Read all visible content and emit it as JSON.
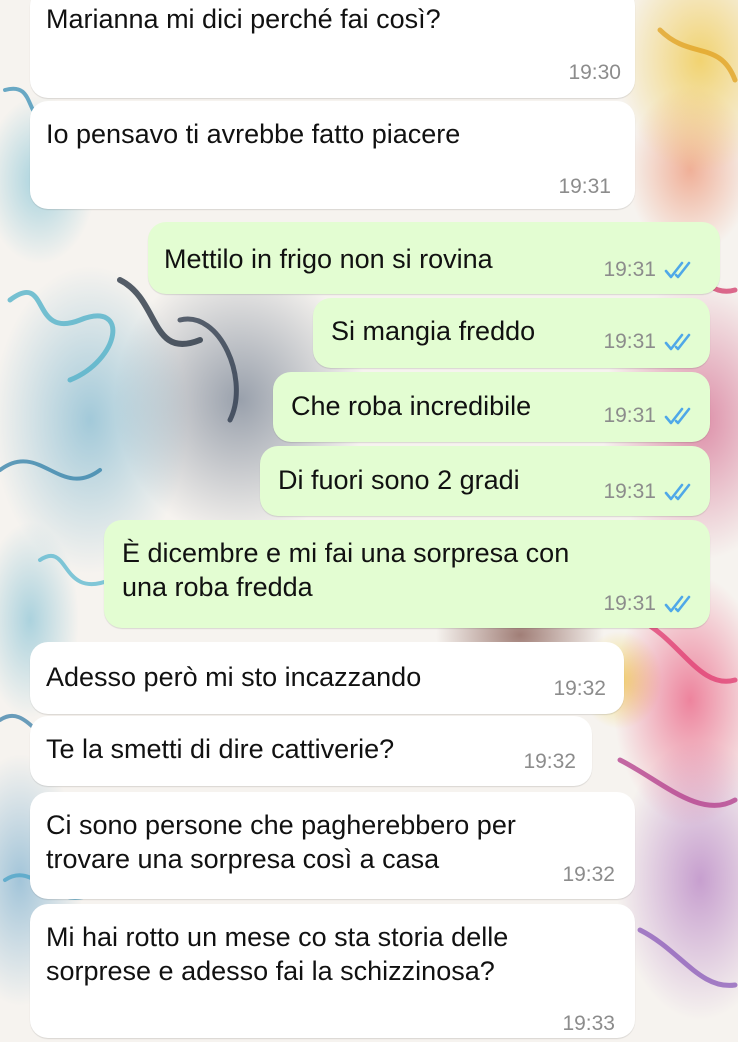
{
  "theme": {
    "incoming_bubble": "#ffffff",
    "outgoing_bubble": "#e3fdd2",
    "read_receipt_color": "#4fa8e8",
    "time_color": "#8c8c8c"
  },
  "messages": [
    {
      "direction": "incoming",
      "text": "Marianna mi dici perché fai così?",
      "time": "19:30"
    },
    {
      "direction": "incoming",
      "text": "Io pensavo ti avrebbe fatto piacere",
      "time": "19:31"
    },
    {
      "direction": "outgoing",
      "text": "Mettilo in frigo non si rovina",
      "time": "19:31",
      "status_icon": "double-check-read-icon"
    },
    {
      "direction": "outgoing",
      "text": "Si mangia freddo",
      "time": "19:31",
      "status_icon": "double-check-read-icon"
    },
    {
      "direction": "outgoing",
      "text": "Che roba incredibile",
      "time": "19:31",
      "status_icon": "double-check-read-icon"
    },
    {
      "direction": "outgoing",
      "text": "Di fuori sono 2 gradi",
      "time": "19:31",
      "status_icon": "double-check-read-icon"
    },
    {
      "direction": "outgoing",
      "text": "È dicembre e mi fai una sorpresa con\nuna roba fredda",
      "time": "19:31",
      "status_icon": "double-check-read-icon"
    },
    {
      "direction": "incoming",
      "text": "Adesso però mi sto incazzando",
      "time": "19:32"
    },
    {
      "direction": "incoming",
      "text": "Te la smetti di dire cattiverie?",
      "time": "19:32"
    },
    {
      "direction": "incoming",
      "text": "Ci sono persone che pagherebbero per\ntrovare una sorpresa così a casa",
      "time": "19:32"
    },
    {
      "direction": "incoming",
      "text": "Mi hai rotto un mese co sta storia delle\nsorprese e adesso fai la schizzinosa?",
      "time": "19:33"
    }
  ]
}
